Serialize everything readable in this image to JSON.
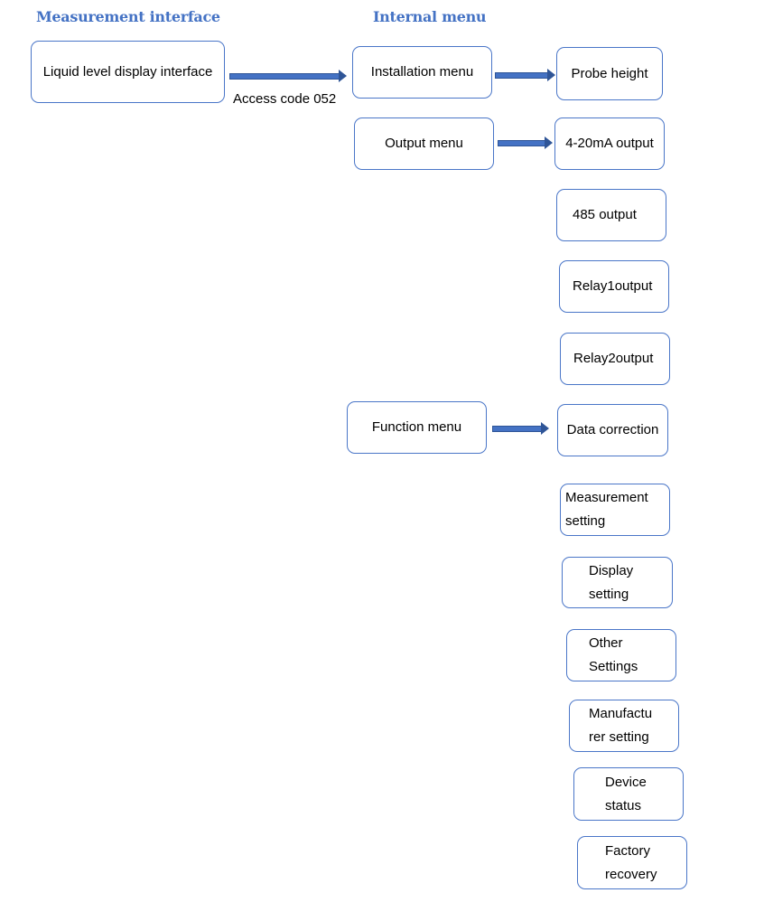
{
  "headers": {
    "measurement": "Measurement interface",
    "internal": "Internal menu"
  },
  "access_label": "Access code 052",
  "nodes": {
    "liquid": "Liquid level display interface",
    "installation": "Installation menu",
    "output": "Output menu",
    "function": "Function menu",
    "probe_height": "Probe height",
    "ma_output": "4-20mA output",
    "rs485_output": "485 output",
    "relay1": "Relay1output",
    "relay2": "Relay2output",
    "data_correction": "Data correction",
    "measurement_setting": "Measurement\nsetting",
    "display_setting": "Display\nsetting",
    "other_settings": "Other\nSettings",
    "manufacturer_setting": "Manufactu\nrer setting",
    "device_status": "Device\nstatus",
    "factory_recovery": "Factory\nrecovery"
  },
  "colors": {
    "accent": "#4472c4",
    "border": "#4a76c8"
  }
}
